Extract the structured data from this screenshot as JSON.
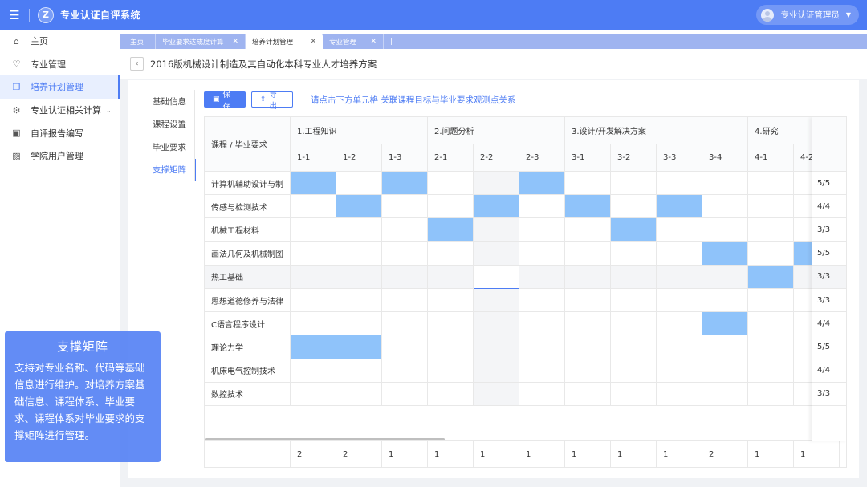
{
  "app": {
    "title": "专业认证自评系统",
    "logo_letter": "Z",
    "user_name": "专业认证管理员"
  },
  "sidebar": {
    "items": [
      {
        "label": "主页",
        "icon": "home-icon",
        "glyph": "⌂"
      },
      {
        "label": "专业管理",
        "icon": "gem-icon",
        "glyph": "♡"
      },
      {
        "label": "培养计划管理",
        "icon": "plan-icon",
        "glyph": "❒"
      },
      {
        "label": "专业认证相关计算",
        "icon": "calc-icon",
        "glyph": "⚙"
      },
      {
        "label": "自评报告编写",
        "icon": "report-icon",
        "glyph": "▣"
      },
      {
        "label": "学院用户管理",
        "icon": "user-mgmt-icon",
        "glyph": "▨"
      }
    ],
    "active_index": 2
  },
  "tabs": [
    {
      "label": "主页",
      "closable": false
    },
    {
      "label": "毕业要求达成度计算",
      "closable": true
    },
    {
      "label": "培养计划管理",
      "closable": true,
      "active": true
    },
    {
      "label": "专业管理",
      "closable": true
    }
  ],
  "page": {
    "title": "2016版机械设计制造及其自动化本科专业人才培养方案"
  },
  "vnav": [
    {
      "label": "基础信息"
    },
    {
      "label": "课程设置"
    },
    {
      "label": "毕业要求"
    },
    {
      "label": "支撑矩阵",
      "active": true
    }
  ],
  "toolbar": {
    "save_label": "保存",
    "export_label": "导出",
    "hint": "请点击下方单元格 关联课程目标与毕业要求观测点关系"
  },
  "matrix": {
    "corner_label": "课程 / 毕业要求",
    "groups": [
      {
        "label": "1.工程知识",
        "span": 3
      },
      {
        "label": "2.问题分析",
        "span": 3
      },
      {
        "label": "3.设计/开发解决方案",
        "span": 4
      },
      {
        "label": "4.研究",
        "span": 2
      }
    ],
    "columns": [
      "1-1",
      "1-2",
      "1-3",
      "2-1",
      "2-2",
      "2-3",
      "3-1",
      "3-2",
      "3-3",
      "3-4",
      "4-1",
      "4-2"
    ],
    "rows": [
      {
        "course": "计算机辅助设计与制",
        "cells": [
          1,
          0,
          1,
          0,
          0,
          1,
          0,
          0,
          0,
          0,
          0,
          0
        ],
        "ratio": "5/5"
      },
      {
        "course": "传感与检测技术",
        "cells": [
          0,
          1,
          0,
          0,
          1,
          0,
          1,
          0,
          1,
          0,
          0,
          0
        ],
        "ratio": "4/4"
      },
      {
        "course": "机械工程材料",
        "cells": [
          0,
          0,
          0,
          1,
          0,
          0,
          0,
          1,
          0,
          0,
          0,
          0
        ],
        "ratio": "3/3"
      },
      {
        "course": "画法几何及机械制图",
        "cells": [
          0,
          0,
          0,
          0,
          0,
          0,
          0,
          0,
          0,
          1,
          0,
          1
        ],
        "ratio": "5/5"
      },
      {
        "course": "热工基础",
        "cells": [
          0,
          0,
          0,
          0,
          0,
          0,
          0,
          0,
          0,
          0,
          1,
          0
        ],
        "ratio": "3/3"
      },
      {
        "course": "思想道德修养与法律",
        "cells": [
          0,
          0,
          0,
          0,
          0,
          0,
          0,
          0,
          0,
          0,
          0,
          0
        ],
        "ratio": "3/3"
      },
      {
        "course": "C语言程序设计",
        "cells": [
          0,
          0,
          0,
          0,
          0,
          0,
          0,
          0,
          0,
          1,
          0,
          0
        ],
        "ratio": "4/4"
      },
      {
        "course": "理论力学",
        "cells": [
          1,
          1,
          0,
          0,
          0,
          0,
          0,
          0,
          0,
          0,
          0,
          0
        ],
        "ratio": "5/5"
      },
      {
        "course": "机床电气控制技术",
        "cells": [
          0,
          0,
          0,
          0,
          0,
          0,
          0,
          0,
          0,
          0,
          0,
          0
        ],
        "ratio": "4/4"
      },
      {
        "course": "数控技术",
        "cells": [
          0,
          0,
          0,
          0,
          0,
          0,
          0,
          0,
          0,
          0,
          0,
          0
        ],
        "ratio": "3/3"
      }
    ],
    "totals": [
      "2",
      "2",
      "1",
      "1",
      "1",
      "1",
      "1",
      "1",
      "1",
      "2",
      "1",
      "1"
    ],
    "selected": {
      "row": 4,
      "col": 4
    },
    "highlight_col": 4,
    "highlight_row": 4,
    "fill_color": "#8fc3fa"
  },
  "info_panel": {
    "title": "支撑矩阵",
    "body": "支持对专业名称、代码等基础信息进行维护。对培养方案基础信息、课程体系、毕业要求、课程体系对毕业要求的支撑矩阵进行管理。"
  },
  "colors": {
    "primary": "#4d7cf4",
    "sidebar_active_bg": "#e8effe"
  }
}
